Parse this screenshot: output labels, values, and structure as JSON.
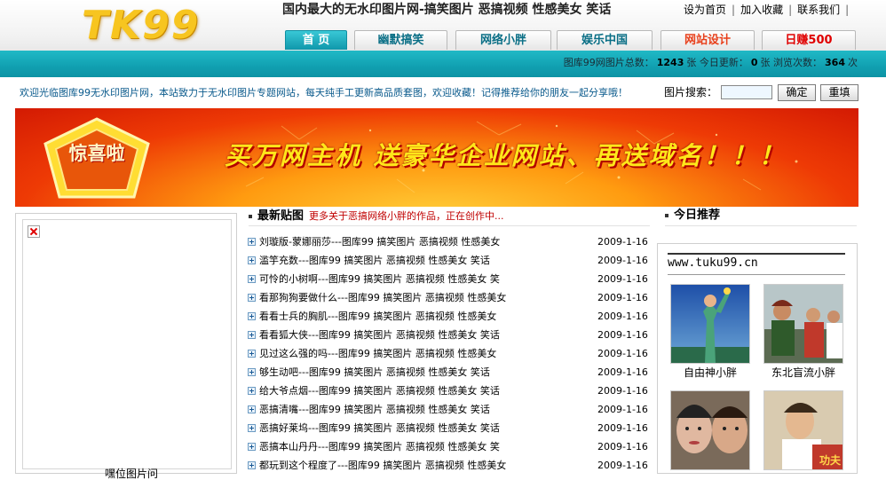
{
  "header": {
    "logo_text": "TK99",
    "slogan": "国内最大的无水印图片网-搞笑图片  恶搞视频  性感美女  笑话",
    "top_links": [
      "设为首页",
      "加入收藏",
      "联系我们"
    ]
  },
  "nav": {
    "tabs": [
      {
        "label": "首 页",
        "active": true
      },
      {
        "label": "幽默搞笑",
        "active": false
      },
      {
        "label": "网络小胖",
        "active": false
      },
      {
        "label": "娱乐中国",
        "active": false
      },
      {
        "label": "网站设计",
        "active": false,
        "color": "#e8401c"
      },
      {
        "label": "日赚500",
        "active": false,
        "color": "#e00000"
      }
    ]
  },
  "stats": {
    "total_label": "图库99网图片总数：",
    "total": "1243",
    "total_unit": "张",
    "today_label": "今日更新：",
    "today": "0",
    "today_unit": "张",
    "views_label": "浏览次数：",
    "views": "364",
    "views_unit": "次"
  },
  "welcome": "欢迎光临图库99无水印图片网，本站致力于无水印图片专题网站，每天纯手工更新高品质套图，欢迎收藏！记得推荐给你的朋友一起分享哦！",
  "search": {
    "label": "图片搜索：",
    "value": "",
    "confirm_label": "确定",
    "reset_label": "重填"
  },
  "banner": {
    "badge_text": "惊喜啦",
    "headline": "买万网主机  送豪华企业网站、再送域名！！！"
  },
  "left_panel": {
    "caption": "嘿位图片问"
  },
  "latest": {
    "title": "最新贴图",
    "note": "更多关于恶搞网络小胖的作品，正在创作中...",
    "posts": [
      {
        "title": "刘璇版-蒙娜丽莎---图库99 搞笑图片 恶搞视频 性感美女",
        "date": "2009-1-16"
      },
      {
        "title": "滥竽充数---图库99 搞笑图片 恶搞视频 性感美女 笑话",
        "date": "2009-1-16"
      },
      {
        "title": "可怜的小树啊---图库99 搞笑图片 恶搞视频 性感美女 笑",
        "date": "2009-1-16"
      },
      {
        "title": "看那狗狗要做什么---图库99 搞笑图片 恶搞视频 性感美女",
        "date": "2009-1-16"
      },
      {
        "title": "看看士兵的胸肌---图库99 搞笑图片 恶搞视频 性感美女",
        "date": "2009-1-16"
      },
      {
        "title": "看看狐大侠---图库99 搞笑图片 恶搞视频 性感美女 笑话",
        "date": "2009-1-16"
      },
      {
        "title": "见过这么强的吗---图库99 搞笑图片 恶搞视频 性感美女",
        "date": "2009-1-16"
      },
      {
        "title": "够生动吧---图库99 搞笑图片 恶搞视频 性感美女 笑话",
        "date": "2009-1-16"
      },
      {
        "title": "给大爷点烟---图库99 搞笑图片 恶搞视频 性感美女 笑话",
        "date": "2009-1-16"
      },
      {
        "title": "恶搞清嘴---图库99 搞笑图片 恶搞视频 性感美女 笑话",
        "date": "2009-1-16"
      },
      {
        "title": "恶搞好莱坞---图库99 搞笑图片 恶搞视频 性感美女 笑话",
        "date": "2009-1-16"
      },
      {
        "title": "恶搞本山丹丹---图库99 搞笑图片 恶搞视频 性感美女 笑",
        "date": "2009-1-16"
      },
      {
        "title": "都玩到这个程度了---图库99 搞笑图片 恶搞视频 性感美女",
        "date": "2009-1-16"
      }
    ]
  },
  "today": {
    "title": "今日推荐",
    "site_url": "www.tuku99.cn",
    "items": [
      {
        "caption": "自由神小胖"
      },
      {
        "caption": "东北盲流小胖"
      },
      {
        "caption": ""
      },
      {
        "caption": ""
      }
    ]
  },
  "colors": {
    "teal": "#11a0b1",
    "logo": "#f7c520",
    "banner_red": "#d31a03",
    "banner_text": "#ffe71a",
    "note_red": "#c00000"
  }
}
